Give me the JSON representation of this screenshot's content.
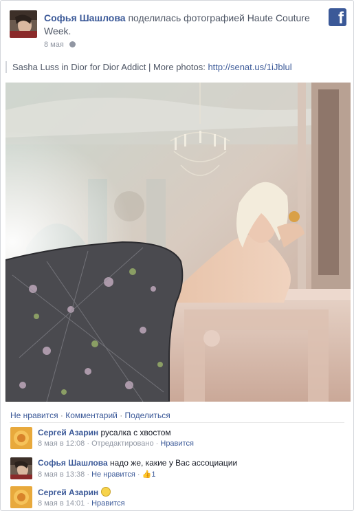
{
  "post": {
    "author": "Софья Шашлова",
    "action": " поделилась фотографией Haute Couture Week.",
    "date": "8 мая",
    "caption_text": "Sasha Luss in Dior for Dior Addict | More photos: ",
    "caption_link": "http://senat.us/1iJblul"
  },
  "actions": {
    "unlike": "Не нравится",
    "sep1": " · ",
    "comment": "Комментарий",
    "sep2": " · ",
    "share": "Поделиться"
  },
  "comments": [
    {
      "author": "Сергей Азарин",
      "text": "русалка с хвостом",
      "time": "8 мая в 12:08",
      "sep1": " · ",
      "edited": "Отредактировано",
      "sep2": " · ",
      "like": "Нравится"
    },
    {
      "author": "Софья Шашлова",
      "text": "надо же, какие у Вас ассоциации",
      "time": "8 мая в 13:38",
      "sep1": " · ",
      "like": "Не нравится",
      "sep2": " · ",
      "like_count": "1"
    },
    {
      "author": "Сергей Азарин",
      "text": "",
      "time": "8 мая в 14:01",
      "sep1": " · ",
      "like": "Нравится"
    }
  ],
  "icons": {
    "logo": "facebook-icon",
    "privacy": "globe-icon",
    "emoji": "smile-icon",
    "like": "thumbs-up-icon"
  },
  "colors": {
    "link": "#3b5998",
    "meta": "#9197a3",
    "border": "#d3d6db"
  }
}
